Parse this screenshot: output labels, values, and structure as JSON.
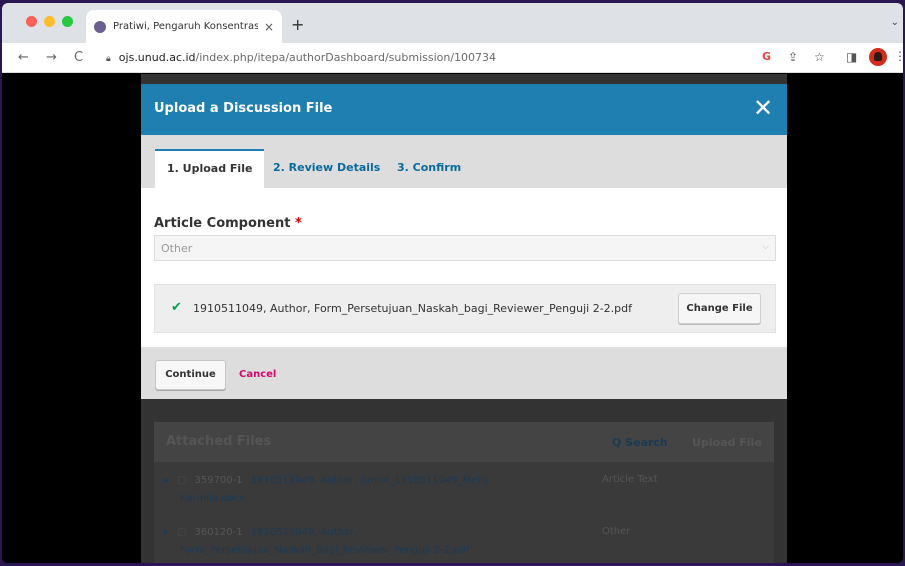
{
  "browser": {
    "tab_title": "Pratiwi, Pengaruh Konsentrasi",
    "tab_close": "×",
    "new_tab": "+",
    "url_host": "ojs.unud.ac.id",
    "url_path": "/index.php/itepa/authorDashboard/submission/100734"
  },
  "modal": {
    "title": "Upload a Discussion File",
    "close_label": "✕",
    "tabs": [
      {
        "label": "1. Upload File",
        "active": true
      },
      {
        "label": "2. Review Details",
        "active": false
      },
      {
        "label": "3. Confirm",
        "active": false
      }
    ],
    "field_label": "Article Component",
    "required_mark": "*",
    "select_value": "Other",
    "file_name": "1910511049, Author, Form_Persetujuan_Naskah_bagi_Reviewer_Penguji 2-2.pdf",
    "change_file_label": "Change File",
    "continue_label": "Continue",
    "cancel_label": "Cancel"
  },
  "attached_files": {
    "title": "Attached Files",
    "search_label": "Q Search",
    "upload_label": "Upload File",
    "rows": [
      {
        "id": "359700-1",
        "name_line1": "1910511049, Author, Jurnal_1910511049_Melly",
        "name_line2": "Karmila.docx",
        "type": "Article Text"
      },
      {
        "id": "360120-1",
        "name_line1": "1910511049, Author,",
        "name_line2": "Form_Persetujuan_Naskah_bagi_Reviewer_Penguji 2-2.pdf",
        "type": "Other"
      }
    ]
  }
}
